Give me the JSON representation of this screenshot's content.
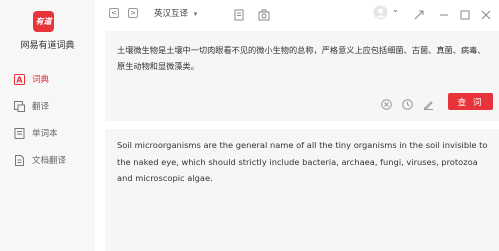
{
  "app": {
    "logo_text": "有道",
    "name": "网易有道词典"
  },
  "sidebar": {
    "items": [
      {
        "label": "词典",
        "icon": "dictionary-icon",
        "active": true
      },
      {
        "label": "翻译",
        "icon": "translate-icon",
        "active": false
      },
      {
        "label": "单词本",
        "icon": "wordbook-icon",
        "active": false
      },
      {
        "label": "文档翻译",
        "icon": "document-translate-icon",
        "active": false
      }
    ]
  },
  "toolbar": {
    "back_label": "<",
    "forward_label": ">",
    "language": "英汉互译",
    "language_caret": "▾",
    "user_caret": "⌄"
  },
  "input": {
    "text": "土壤微生物是土壤中一切肉眼看不见的微小生物的总称，严格意义上应包括细菌、古菌、真菌、病毒、原生动物和显微藻类。",
    "query_label": "查 词"
  },
  "output": {
    "text": "Soil microorganisms are the general name of all the tiny organisms in the soil invisible to the naked eye, which should strictly include bacteria, archaea, fungi, viruses, protozoa and microscopic algae."
  },
  "colors": {
    "accent": "#e8333a",
    "sidebar_bg": "#f7f7f7",
    "panel_bg": "#f6f6f6"
  }
}
